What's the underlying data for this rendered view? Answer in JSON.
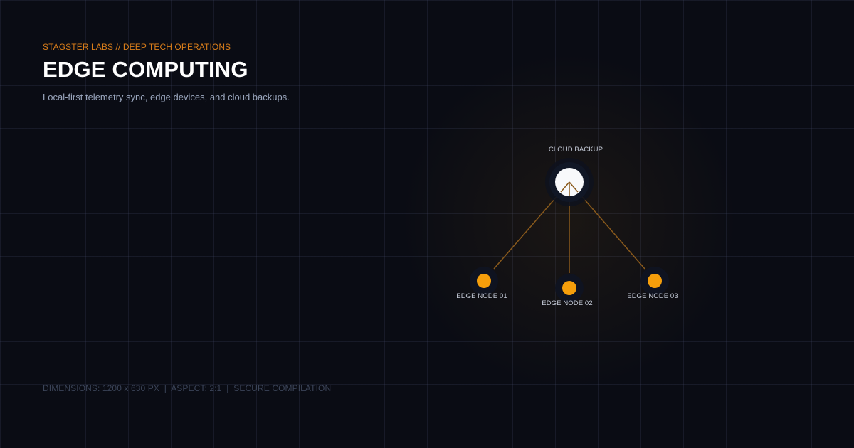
{
  "header": {
    "eyebrow": "STAGSTER LABS // DEEP TECH OPERATIONS",
    "title": "EDGE COMPUTING",
    "subtitle": "Local-first telemetry sync, edge devices, and cloud backups."
  },
  "footer": {
    "text": "DIMENSIONS: 1200 x 630 PX  |  ASPECT: 2:1  |  SECURE COMPILATION"
  },
  "diagram": {
    "hub": {
      "label": "CLOUD BACKUP"
    },
    "nodes": [
      {
        "label": "EDGE NODE 01"
      },
      {
        "label": "EDGE NODE 02"
      },
      {
        "label": "EDGE NODE 03"
      }
    ]
  },
  "colors": {
    "accent": "#f59e0b",
    "eyebrow": "#d97d1a",
    "hub_fill": "#f8f9fb",
    "link": "#8a5a1c",
    "background": "#0a0c14"
  }
}
